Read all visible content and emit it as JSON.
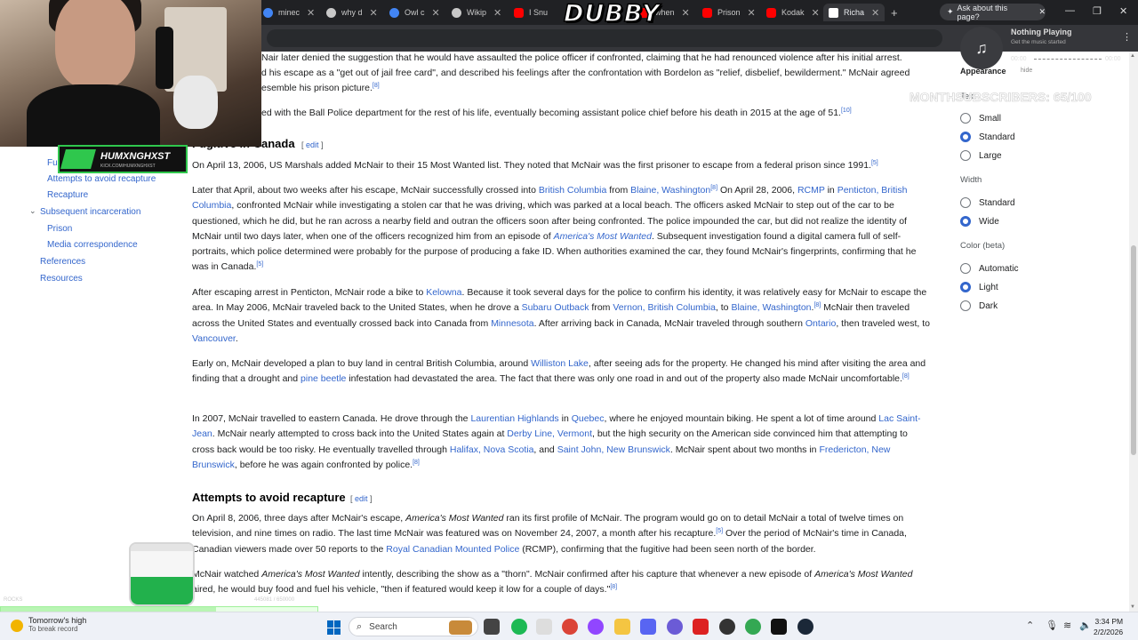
{
  "browser": {
    "tabs": [
      {
        "label": "minec",
        "color": "#4285f4"
      },
      {
        "label": "why d",
        "color": "#c8c8c8"
      },
      {
        "label": "Owl c",
        "color": "#4285f4"
      },
      {
        "label": "Wikip",
        "color": "#c8c8c8"
      },
      {
        "label": "I Snu",
        "color": "#ff0000"
      },
      {
        "label": "when",
        "color": "#ff0000"
      },
      {
        "label": "Prison",
        "color": "#ff0000"
      },
      {
        "label": "Kodak",
        "color": "#ff0000"
      },
      {
        "label": "Richa",
        "color": "#ffffff"
      }
    ],
    "new_tab": "+",
    "ask_label": "Ask about this page?"
  },
  "overlays": {
    "logo_text": "DUBBY",
    "music_title": "Nothing Playing",
    "music_sub": "Get the music started",
    "music_time_start": "00:00",
    "music_time_end": "00:00",
    "subscribers_text": "MONTHSUBSCRIBERS: 65/100",
    "streamer_name": "HUMXNGHXST",
    "streamer_sub": "KICK.COM/HUMXNGHXST",
    "jar_left_count": "ROCKS",
    "jar_right_count": "445081 / 650000",
    "progress_fraction": 0.68
  },
  "toc": {
    "partial": "Fu",
    "items": [
      {
        "label": "Attempts to avoid recapture"
      },
      {
        "label": "Recapture"
      },
      {
        "label": "Subsequent incarceration"
      },
      {
        "label": "Prison"
      },
      {
        "label": "Media correspondence"
      },
      {
        "label": "References"
      },
      {
        "label": "Resources"
      }
    ]
  },
  "article": {
    "p0a": "Nair later denied the suggestion that he would have assaulted the police officer if confronted, claiming that he had renounced violence after his initial arrest.",
    "p0b": "d his escape as a \"get out of jail free card\", and described his feelings after the confrontation with Bordelon as \"relief, disbelief, bewilderment.\" McNair agreed",
    "p0c": "esemble his prison picture.",
    "p0_ref": "[8]",
    "p1": "ed with the Ball Police department for the rest of his life, eventually becoming assistant police chief before his death in 2015 at the age of 51.",
    "p1_ref": "[10]",
    "h_canada": "Fugitive in Canada",
    "edit_label": "edit",
    "p2": "On April 13, 2006, US Marshals added McNair to their 15 Most Wanted list. They noted that McNair was the first prisoner to escape from a federal prison since 1991.",
    "p2_ref": "[5]",
    "p3": {
      "a": "Later that April, about two weeks after his escape, McNair successfully crossed into ",
      "l1": "British Columbia",
      "b": " from ",
      "l2": "Blaine, Washington",
      "r1": "[8]",
      "c": " On April 28, 2006, ",
      "l3": "RCMP",
      "d": " in ",
      "l4": "Penticton, British Columbia",
      "e": ", confronted McNair while investigating a stolen car that he was driving, which was parked at a local beach. The officers asked McNair to step out of the car to be questioned, which he did, but he ran across a nearby field and outran the officers soon after being confronted. The police impounded the car, but did not realize the identity of McNair until two days later, when one of the officers recognized him from an episode of ",
      "l5": "America's Most Wanted",
      "f": ". Subsequent investigation found a digital camera full of self-portraits, which police determined were probably for the purpose of producing a fake ID. When authorities examined the car, they found McNair's fingerprints, confirming that he was in Canada.",
      "r2": "[5]"
    },
    "p4": {
      "a": "After escaping arrest in Penticton, McNair rode a bike to ",
      "l1": "Kelowna",
      "b": ". Because it took several days for the police to confirm his identity, it was relatively easy for McNair to escape the area. In May 2006, McNair traveled back to the United States, when he drove a ",
      "l2": "Subaru Outback",
      "c": " from ",
      "l3": "Vernon, British Columbia",
      "d": ", to ",
      "l4": "Blaine, Washington",
      "e": ".",
      "r1": "[8]",
      "f": " McNair then traveled across the United States and eventually crossed back into Canada from ",
      "l5": "Minnesota",
      "g": ". After arriving back in Canada, McNair traveled through southern ",
      "l6": "Ontario",
      "h": ", then traveled west, to ",
      "l7": "Vancouver",
      "i": "."
    },
    "p5": {
      "a": "Early on, McNair developed a plan to buy land in central British Columbia, around ",
      "l1": "Williston Lake",
      "b": ", after seeing ads for the property. He changed his mind after visiting the area and finding that a drought and ",
      "l2": "pine beetle",
      "c": " infestation had devastated the area. The fact that there was only one road in and out of the property also made McNair uncomfortable.",
      "r1": "[8]"
    },
    "p6": {
      "a": "In 2007, McNair travelled to eastern Canada. He drove through the ",
      "l1": "Laurentian Highlands",
      "b": " in ",
      "l2": "Quebec",
      "c": ", where he enjoyed mountain biking. He spent a lot of time around ",
      "l3": "Lac Saint-Jean",
      "d": ". McNair nearly attempted to cross back into the United States again at ",
      "l4": "Derby Line, Vermont",
      "e": ", but the high security on the American side convinced him that attempting to cross back would be too risky. He eventually travelled through ",
      "l5": "Halifax, Nova Scotia",
      "f": ", and ",
      "l6": "Saint John, New Brunswick",
      "g": ". McNair spent about two months in ",
      "l7": "Fredericton, New Brunswick",
      "h": ", before he was again confronted by police.",
      "r1": "[8]"
    },
    "h_attempts": "Attempts to avoid recapture",
    "p7": {
      "a": "On April 8, 2006, three days after McNair's escape, ",
      "i1": "America's Most Wanted",
      "b": " ran its first profile of McNair. The program would go on to detail McNair a total of twelve times on television, and nine times on radio. The last time McNair was featured was on November 24, 2007, a month after his recapture.",
      "r1": "[5]",
      "c": " Over the period of McNair's time in Canada, Canadian viewers made over 50 reports to the ",
      "l1": "Royal Canadian Mounted Police",
      "d": " (RCMP), confirming that the fugitive had been seen north of the border."
    },
    "p8": {
      "a": "McNair watched ",
      "i1": "America's Most Wanted",
      "b": " intently, describing the show as a \"thorn\". McNair confirmed after his capture that whenever a new episode of ",
      "i2": "America's Most Wanted",
      "c": " aired, he would buy food and fuel his vehicle, \"then if featured would keep it low for a couple of days.\"",
      "r1": "[8]"
    }
  },
  "appearance": {
    "heading": "Appearance",
    "hide": "hide",
    "text_label": "Text",
    "text_options": [
      {
        "label": "Small",
        "selected": false
      },
      {
        "label": "Standard",
        "selected": true
      },
      {
        "label": "Large",
        "selected": false
      }
    ],
    "width_label": "Width",
    "width_options": [
      {
        "label": "Standard",
        "selected": false
      },
      {
        "label": "Wide",
        "selected": true
      }
    ],
    "color_label": "Color (beta)",
    "color_options": [
      {
        "label": "Automatic",
        "selected": false
      },
      {
        "label": "Light",
        "selected": true
      },
      {
        "label": "Dark",
        "selected": false
      }
    ]
  },
  "taskbar": {
    "weather_title": "Tomorrow's high",
    "weather_sub": "To break record",
    "search_placeholder": "Search",
    "time": "3:34 PM",
    "date": "2/2/2026"
  }
}
